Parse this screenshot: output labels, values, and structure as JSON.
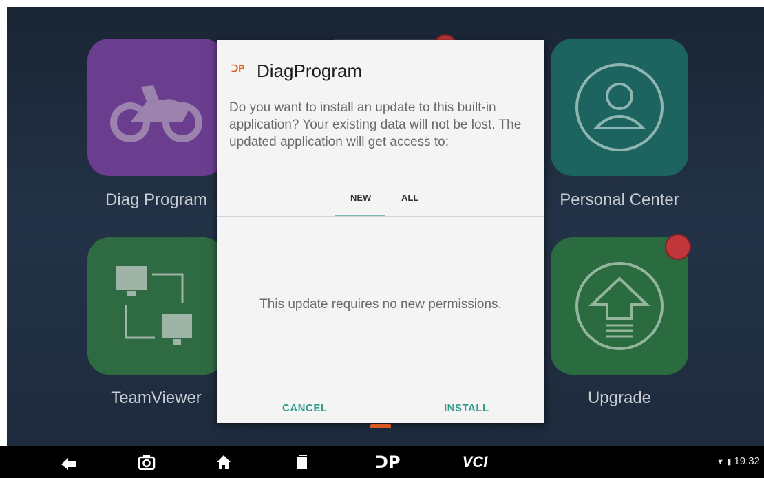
{
  "home": {
    "tiles": [
      {
        "label": "Diag Program",
        "icon": "motorcycle-icon",
        "color": "#6a3d8f"
      },
      {
        "label": "Personal Center",
        "icon": "person-icon",
        "color": "#1d6460"
      },
      {
        "label": "TeamViewer",
        "icon": "teamviewer-monitors-icon",
        "color": "#2f6b42"
      },
      {
        "label": "Upgrade",
        "icon": "upgrade-arrow-icon",
        "color": "#2a6b3f"
      }
    ]
  },
  "dialog": {
    "title": "DiagProgram",
    "logo_text": "ᑐP",
    "message": "Do you want to install an update to this built-in application? Your existing data will not be lost. The updated application will get access to:",
    "tabs": [
      "NEW",
      "ALL"
    ],
    "selected_tab": "NEW",
    "permissions_message": "This update requires no new permissions.",
    "cancel_label": "CANCEL",
    "install_label": "INSTALL",
    "accent": "#2f9b8f"
  },
  "navbar": {
    "items": [
      "back-icon",
      "screenshot-icon",
      "home-icon",
      "recent-apps-icon",
      "dp-logo-icon",
      "vci-icon"
    ],
    "dp_text": "ᑐP",
    "vci_label": "VCI",
    "time": "19:32"
  }
}
